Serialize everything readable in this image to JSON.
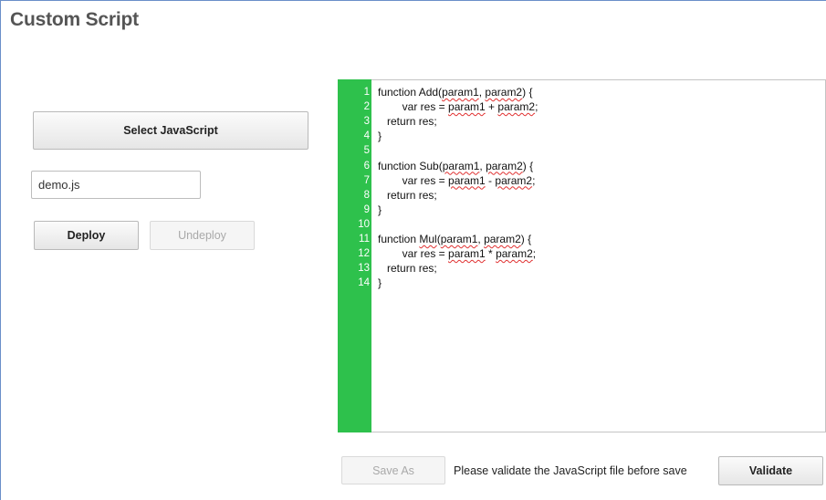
{
  "page": {
    "title": "Custom Script"
  },
  "left_panel": {
    "select_button_label": "Select JavaScript",
    "file_name_value": "demo.js",
    "deploy_label": "Deploy",
    "undeploy_label": "Undeploy"
  },
  "editor": {
    "line_numbers": [
      "1",
      "2",
      "3",
      "4",
      "5",
      "6",
      "7",
      "8",
      "9",
      "10",
      "11",
      "12",
      "13",
      "14"
    ],
    "lines": [
      {
        "indent": "",
        "parts": [
          {
            "t": "function Add("
          },
          {
            "t": "param1",
            "s": true
          },
          {
            "t": ", "
          },
          {
            "t": "param2",
            "s": true
          },
          {
            "t": ") {"
          }
        ]
      },
      {
        "indent": "        ",
        "parts": [
          {
            "t": "var res = "
          },
          {
            "t": "param1",
            "s": true
          },
          {
            "t": " + "
          },
          {
            "t": "param2",
            "s": true
          },
          {
            "t": ";"
          }
        ]
      },
      {
        "indent": "   ",
        "parts": [
          {
            "t": "return res;"
          }
        ]
      },
      {
        "indent": "",
        "parts": [
          {
            "t": "}"
          }
        ]
      },
      {
        "indent": "",
        "parts": []
      },
      {
        "indent": "",
        "parts": [
          {
            "t": "function Sub("
          },
          {
            "t": "param1",
            "s": true
          },
          {
            "t": ", "
          },
          {
            "t": "param2",
            "s": true
          },
          {
            "t": ") {"
          }
        ]
      },
      {
        "indent": "        ",
        "parts": [
          {
            "t": "var res = "
          },
          {
            "t": "param1",
            "s": true
          },
          {
            "t": " - "
          },
          {
            "t": "param2",
            "s": true
          },
          {
            "t": ";"
          }
        ]
      },
      {
        "indent": "   ",
        "parts": [
          {
            "t": "return res;"
          }
        ]
      },
      {
        "indent": "",
        "parts": [
          {
            "t": "}"
          }
        ]
      },
      {
        "indent": "",
        "parts": []
      },
      {
        "indent": "",
        "parts": [
          {
            "t": "function "
          },
          {
            "t": "Mul",
            "s": true
          },
          {
            "t": "("
          },
          {
            "t": "param1",
            "s": true
          },
          {
            "t": ", "
          },
          {
            "t": "param2",
            "s": true
          },
          {
            "t": ") {"
          }
        ]
      },
      {
        "indent": "        ",
        "parts": [
          {
            "t": "var res = "
          },
          {
            "t": "param1",
            "s": true
          },
          {
            "t": " * "
          },
          {
            "t": "param2",
            "s": true
          },
          {
            "t": ";"
          }
        ]
      },
      {
        "indent": "   ",
        "parts": [
          {
            "t": "return res;"
          }
        ]
      },
      {
        "indent": "",
        "parts": [
          {
            "t": "}"
          }
        ]
      }
    ],
    "gutter_color": "#2ec14c"
  },
  "footer": {
    "save_as_label": "Save As",
    "hint_text": "Please validate the JavaScript file before save",
    "validate_label": "Validate"
  }
}
